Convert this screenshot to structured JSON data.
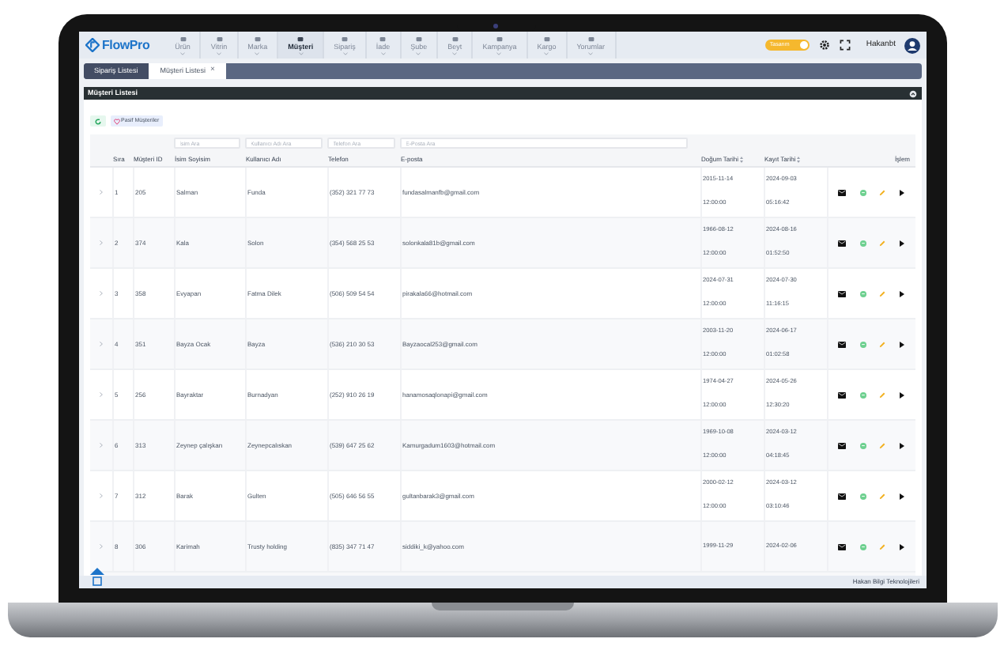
{
  "brand": "FlowPro",
  "nav": [
    {
      "label": "Ürün",
      "selected": false
    },
    {
      "label": "Vitrin",
      "selected": false
    },
    {
      "label": "Marka",
      "selected": false
    },
    {
      "label": "Müşteri",
      "selected": true
    },
    {
      "label": "Sipariş",
      "selected": false
    },
    {
      "label": "İade",
      "selected": false
    },
    {
      "label": "Şube",
      "selected": false
    },
    {
      "label": "Beyt",
      "selected": false
    },
    {
      "label": "Kampanya",
      "selected": false
    },
    {
      "label": "Kargo",
      "selected": false
    },
    {
      "label": "Yorumlar",
      "selected": false
    }
  ],
  "theme_toggle": {
    "label": "Tasarım",
    "on": true
  },
  "user": "Hakanbt",
  "tabs": [
    {
      "label": "Sipariş Listesi",
      "selected": false
    },
    {
      "label": "Müşteri Listesi",
      "selected": true,
      "close": "×"
    }
  ],
  "card_title": "Müşteri Listesi",
  "toolbar": {
    "passive_button": "Pasif Müşteriler"
  },
  "filters": [
    {
      "placeholder": "İsim Ara"
    },
    {
      "placeholder": "Kullanıcı Adı Ara"
    },
    {
      "placeholder": "Telefon Ara"
    },
    {
      "placeholder": "E-Posta Ara"
    }
  ],
  "columns": [
    "Sıra",
    "Müşteri ID",
    "İsim Soyisim",
    "Kullanıcı Adı",
    "Telefon",
    "E-posta",
    "Doğum Tarihi",
    "Kayıt Tarihi",
    "İşlem"
  ],
  "rows": [
    {
      "cells": [
        "1",
        "205",
        "Salman",
        "Funda",
        "(352) 321 77 73",
        "fundasalmanfb@gmail.com"
      ],
      "birth": [
        "2015-11-14",
        "12:00:00"
      ],
      "created": [
        "2024-09-03",
        "05:16:42"
      ]
    },
    {
      "cells": [
        "2",
        "374",
        "Kala",
        "Solon",
        "(354) 568 25 53",
        "solonkala81b@gmail.com"
      ],
      "birth": [
        "1966-08-12",
        "12:00:00"
      ],
      "created": [
        "2024-08-16",
        "01:52:50"
      ]
    },
    {
      "cells": [
        "3",
        "358",
        "Evyapan",
        "Fatma Dilek",
        "(506) 509 54 54",
        "pirakala66@hotmail.com"
      ],
      "birth": [
        "2024-07-31",
        "12:00:00"
      ],
      "created": [
        "2024-07-30",
        "11:16:15"
      ]
    },
    {
      "cells": [
        "4",
        "351",
        "Bayza Ocak",
        "Bayza",
        "(536) 210 30 53",
        "Bayzaocal253@gmail.com"
      ],
      "birth": [
        "2003-11-20",
        "12:00:00"
      ],
      "created": [
        "2024-06-17",
        "01:02:58"
      ]
    },
    {
      "cells": [
        "5",
        "256",
        "Bayraktar",
        "Burnadyan",
        "(252) 910 26 19",
        "hanamosaqlonapi@gmail.com"
      ],
      "birth": [
        "1974-04-27",
        "12:00:00"
      ],
      "created": [
        "2024-05-26",
        "12:30:20"
      ]
    },
    {
      "cells": [
        "6",
        "313",
        "Zeynep çalışkan",
        "Zeynepcalıskan",
        "(539) 647 25 62",
        "Kamurgadum1603@hotmail.com"
      ],
      "birth": [
        "1969-10-08",
        "12:00:00"
      ],
      "created": [
        "2024-03-12",
        "04:18:45"
      ]
    },
    {
      "cells": [
        "7",
        "312",
        "Barak",
        "Gulten",
        "(505) 646 56 55",
        "gultanbarak3@gmail.com"
      ],
      "birth": [
        "2000-02-12",
        "12:00:00"
      ],
      "created": [
        "2024-03-12",
        "03:10:46"
      ]
    },
    {
      "cells": [
        "8",
        "306",
        "Karimah",
        "Trusty holding",
        "(835) 347 71 47",
        "siddiki_k@yahoo.com"
      ],
      "birth": [
        "1999-11-29"
      ],
      "created": [
        "2024-02-06"
      ]
    }
  ],
  "footer": "Hakan Bilgi Teknolojileri"
}
